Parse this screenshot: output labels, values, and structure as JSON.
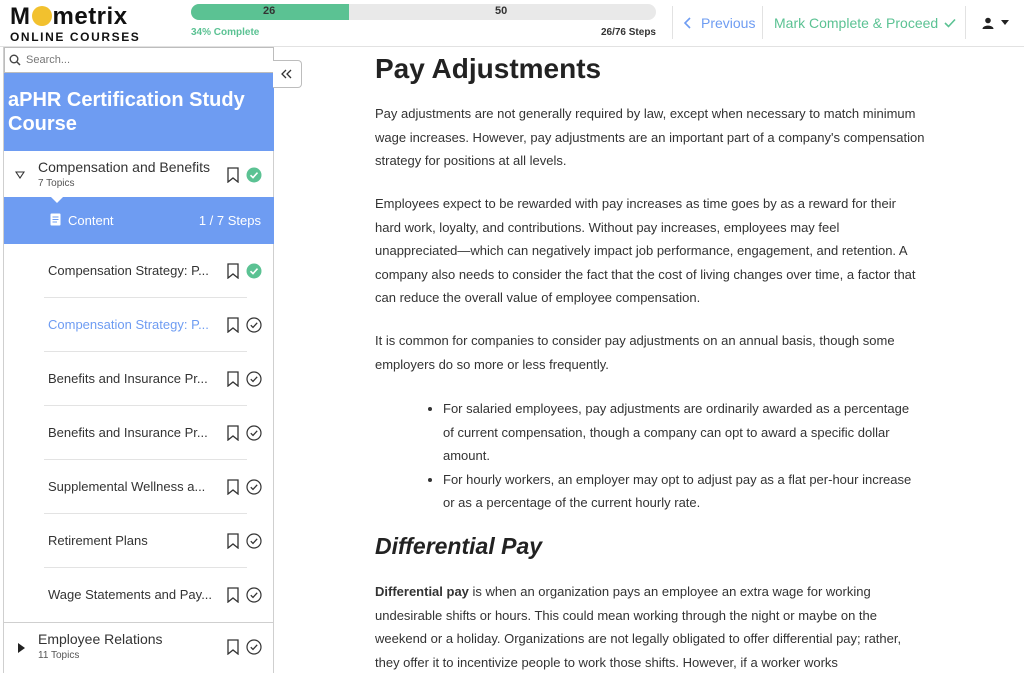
{
  "brand": {
    "logo_main": "Mometrix",
    "logo_sub": "ONLINE COURSES"
  },
  "progress": {
    "start_label": "26",
    "end_label": "50",
    "percent_complete": 34,
    "percent_text": "34% Complete",
    "steps_text": "26/76 Steps"
  },
  "nav": {
    "previous_label": "Previous",
    "proceed_label": "Mark Complete & Proceed"
  },
  "colors": {
    "accent_blue": "#6e9cf2",
    "accent_green": "#5bc293"
  },
  "sidebar": {
    "search_placeholder": "Search...",
    "course_title": "aPHR Certification Study Course",
    "sections": [
      {
        "title": "Compensation and Benefits",
        "subtitle": "7 Topics",
        "completed": true,
        "content_row": {
          "label": "Content",
          "count": "1 / 7 Steps"
        },
        "topics": [
          {
            "title": "Compensation Strategy: P...",
            "completed": true
          },
          {
            "title": "Compensation Strategy: P...",
            "completed": false
          },
          {
            "title": "Benefits and Insurance Pr...",
            "completed": false
          },
          {
            "title": "Benefits and Insurance Pr...",
            "completed": false
          },
          {
            "title": "Supplemental Wellness a...",
            "completed": false
          },
          {
            "title": "Retirement Plans",
            "completed": false
          },
          {
            "title": "Wage Statements and Pay...",
            "completed": false
          }
        ]
      },
      {
        "title": "Employee Relations",
        "subtitle": "11 Topics",
        "completed": false
      }
    ]
  },
  "main": {
    "title": "Pay Adjustments",
    "paragraphs": [
      "Pay adjustments are not generally required by law, except when necessary to match minimum wage increases. However, pay adjustments are an important part of a company's compensation strategy for positions at all levels.",
      "Employees expect to be rewarded with pay increases as time goes by as a reward for their hard work, loyalty, and contributions. Without pay increases, employees may feel unappreciated—which can negatively impact job performance, engagement, and retention. A company also needs to consider the fact that the cost of living changes over time, a factor that can reduce the overall value of employee compensation.",
      "It is common for companies to consider pay adjustments on an annual basis, though some employers do so more or less frequently."
    ],
    "bullets": [
      "For salaried employees, pay adjustments are ordinarily awarded as a percentage of current compensation, though a company can opt to award a specific dollar amount.",
      "For hourly workers, an employer may opt to adjust pay as a flat per-hour increase or as a percentage of the current hourly rate."
    ],
    "subheading": "Differential Pay",
    "differential_term": "Differential pay",
    "differential_text": " is when an organization pays an employee an extra wage for working undesirable shifts or hours. This could mean working through the night or maybe on the weekend or a holiday. Organizations are not legally obligated to offer differential pay; rather, they offer it to incentivize people to work those shifts. However, if a worker works"
  }
}
